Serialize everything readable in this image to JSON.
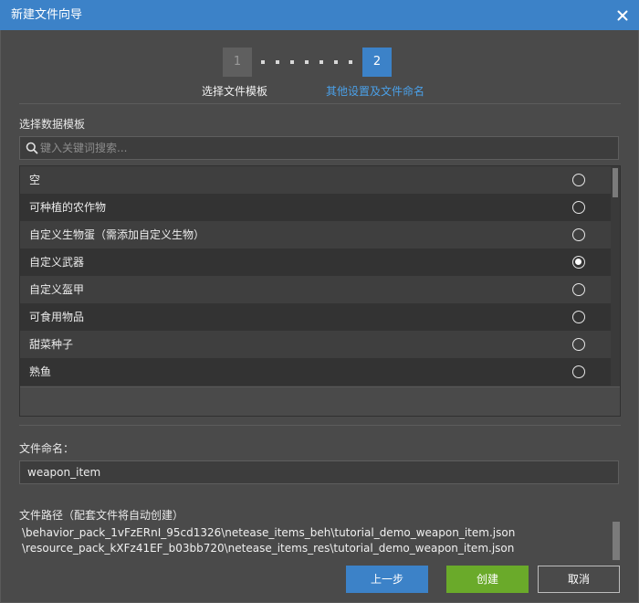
{
  "window": {
    "title": "新建文件向导"
  },
  "stepper": {
    "steps": [
      {
        "number": "1",
        "label": "选择文件模板",
        "active": false
      },
      {
        "number": "2",
        "label": "其他设置及文件命名",
        "active": true
      }
    ]
  },
  "template_section": {
    "label": "选择数据模板",
    "search_placeholder": "键入关键词搜索...",
    "items": [
      {
        "label": "空",
        "selected": false
      },
      {
        "label": "可种植的农作物",
        "selected": false
      },
      {
        "label": "自定义生物蛋（需添加自定义生物）",
        "selected": false
      },
      {
        "label": "自定义武器",
        "selected": true
      },
      {
        "label": "自定义盔甲",
        "selected": false
      },
      {
        "label": "可食用物品",
        "selected": false
      },
      {
        "label": "甜菜种子",
        "selected": false
      },
      {
        "label": "熟鱼",
        "selected": false
      }
    ]
  },
  "naming": {
    "label": "文件命名：",
    "value": "weapon_item"
  },
  "file_path": {
    "label": "文件路径（配套文件将自动创建）",
    "lines": [
      "\\behavior_pack_1vFzERnI_95cd1326\\netease_items_beh\\tutorial_demo_weapon_item.json",
      "\\resource_pack_kXFz41EF_b03bb720\\netease_items_res\\tutorial_demo_weapon_item.json"
    ]
  },
  "buttons": {
    "prev": "上一步",
    "create": "创建",
    "cancel": "取消"
  },
  "colors": {
    "accent": "#3c82c8",
    "create": "#6aaa2a",
    "active_step_label": "#4aa0e8"
  }
}
